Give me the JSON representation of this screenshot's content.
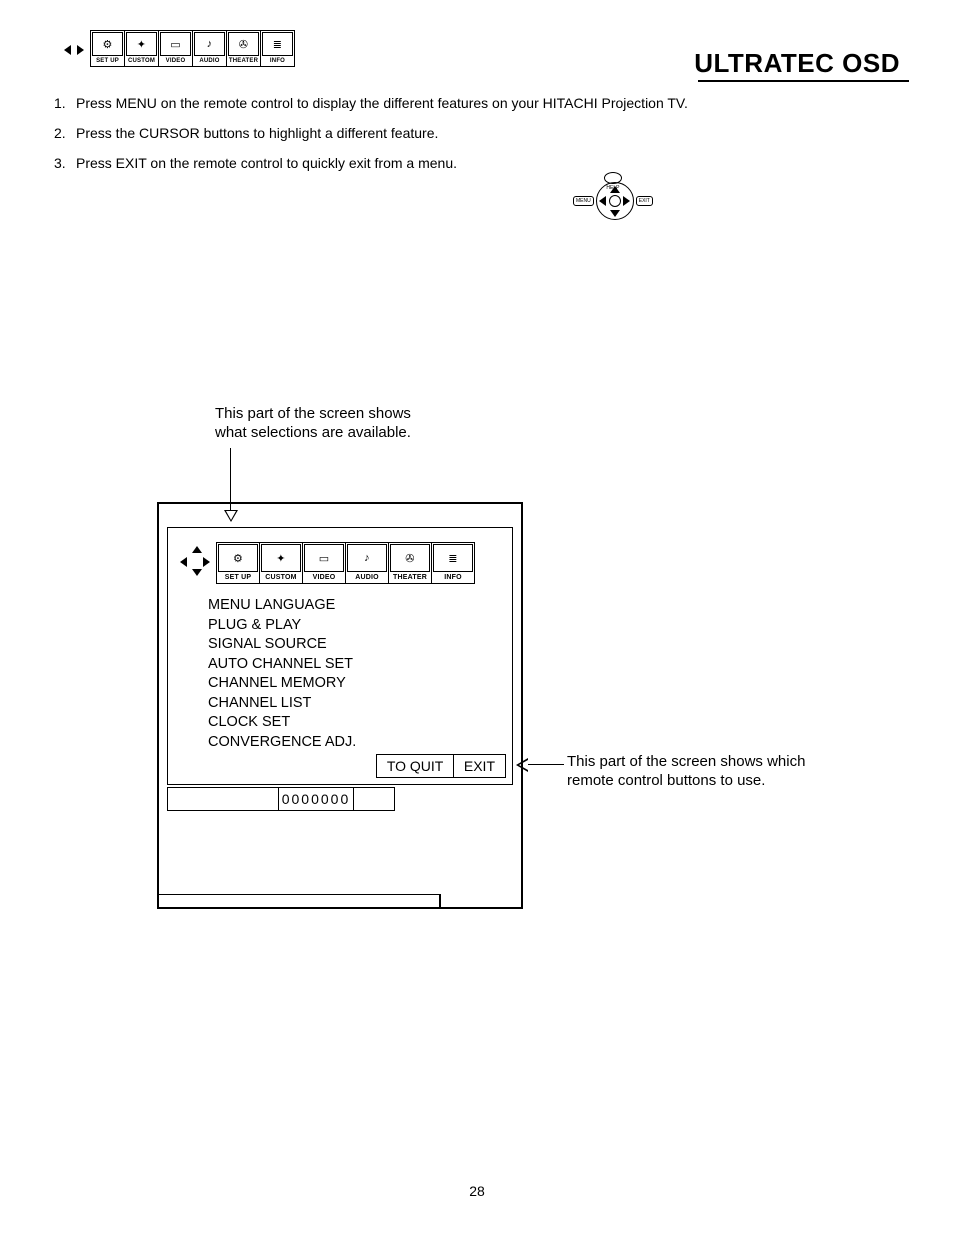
{
  "title": "ULTRATEC OSD",
  "tabstrip": {
    "labels": [
      "SET UP",
      "CUSTOM",
      "VIDEO",
      "AUDIO",
      "THEATER",
      "INFO"
    ]
  },
  "steps": [
    "Press MENU on the remote control to display the different features on your HITACHI Projection TV.",
    "Press the CURSOR buttons to highlight a different feature.",
    "Press EXIT on the remote control to quickly exit from a menu."
  ],
  "remote": {
    "help": "HELP",
    "menu": "MENU",
    "exit": "EXIT"
  },
  "callouts": {
    "top": "This part of the screen shows what selections are available.",
    "right": "This part of the screen shows which remote control buttons to use."
  },
  "setup_menu": [
    "MENU LANGUAGE",
    "PLUG & PLAY",
    "SIGNAL SOURCE",
    "AUTO CHANNEL SET",
    "CHANNEL MEMORY",
    "CHANNEL LIST",
    "CLOCK SET",
    "CONVERGENCE ADJ."
  ],
  "quit": {
    "label": "TO QUIT",
    "button": "EXIT"
  },
  "counter": "0000000",
  "page_number": "28"
}
